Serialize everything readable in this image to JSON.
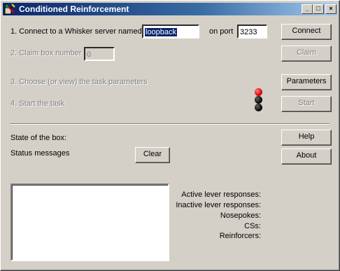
{
  "window": {
    "title": "Conditioned Reinforcement",
    "minimize_glyph": "_",
    "maximize_glyph": "□",
    "close_glyph": "×"
  },
  "steps": {
    "step1": "1. Connect to a Whisker server named",
    "server_value": "loopback",
    "on_port": "on port",
    "port_value": "3233",
    "step2": "2. Claim box number",
    "box_value": "0",
    "step3": "3. Choose (or view) the task parameters",
    "step4": "4. Start the task"
  },
  "buttons": {
    "connect": "Connect",
    "claim": "Claim",
    "parameters": "Parameters",
    "start": "Start",
    "help": "Help",
    "about": "About",
    "clear": "Clear"
  },
  "status": {
    "state_label": "State of the box:",
    "messages_label": "Status messages"
  },
  "stats": {
    "active": "Active lever responses:",
    "inactive": "Inactive lever responses:",
    "nosepokes": "Nosepokes:",
    "css": "CSs:",
    "reinforcers": "Reinforcers:"
  },
  "indicator": {
    "lights": [
      "red",
      "black",
      "black"
    ],
    "colors": {
      "red": "#e00000",
      "black": "#000000"
    }
  }
}
